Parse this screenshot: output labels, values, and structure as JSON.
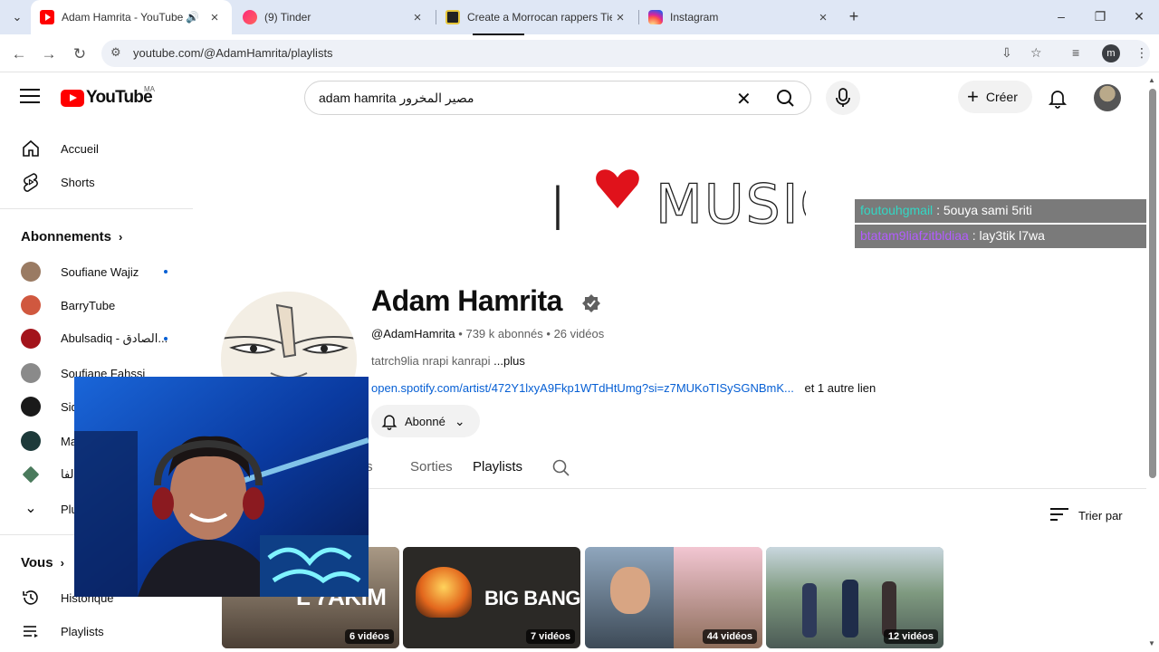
{
  "browser": {
    "tabs": [
      {
        "title": "Adam Hamrita - YouTube",
        "active": true
      },
      {
        "title": "(9) Tinder",
        "active": false
      },
      {
        "title": "Create a Morrocan rappers Tier",
        "active": false
      },
      {
        "title": "Instagram",
        "active": false
      }
    ],
    "url": "youtube.com/@AdamHamrita/playlists",
    "profile_initial": "m"
  },
  "youtube": {
    "logo_text": "YouTube",
    "country_code": "MA",
    "search_query": "adam hamrita مصير المخرور",
    "create_label": "Créer"
  },
  "sidebar": {
    "home": "Accueil",
    "shorts": "Shorts",
    "subscriptions_heading": "Abonnements",
    "subscriptions": [
      {
        "name": "Soufiane Wajiz",
        "new": true,
        "color": "#9a7b63"
      },
      {
        "name": "BarryTube",
        "new": false,
        "color": "#d0583f"
      },
      {
        "name": "Abulsadiq - الصادق...",
        "new": true,
        "color": "#a3141b"
      },
      {
        "name": "Soufiane Fahssi",
        "new": false,
        "color": "#8a8a8a"
      },
      {
        "name": "Sid",
        "new": false,
        "color": "#1a1a1a"
      },
      {
        "name": "Ma",
        "new": false,
        "color": "#1d3a3a"
      },
      {
        "name": "ية الفا",
        "new": false,
        "color": "#4a7a5c"
      }
    ],
    "more_label": "Plus",
    "you_heading": "Vous",
    "history": "Historique",
    "playlists": "Playlists"
  },
  "channel": {
    "name": "Adam Hamrita",
    "handle": "@AdamHamrita",
    "subscribers": "739 k abonnés",
    "videos": "26 vidéos",
    "description": "tatrch9lia nrapi kanrapi",
    "more": "...plus",
    "link": "open.spotify.com/artist/472Y1lxyA9Fkp1WTdHtUmg?si=z7MUKoTISySGNBmK...",
    "other_links": "et 1 autre lien",
    "subscribed_label": "Abonné",
    "banner_left_text": "I",
    "banner_right_text": "MUSIC"
  },
  "tabs": [
    {
      "label": "rts",
      "active": false
    },
    {
      "label": "Sorties",
      "active": false
    },
    {
      "label": "Playlists",
      "active": true
    }
  ],
  "sort_label": "Trier par",
  "playlists": [
    {
      "title_overlay": "L'7AKIM",
      "count": "6 vidéos",
      "bg": "#6d5c4e"
    },
    {
      "title_overlay": "BIG BANG",
      "count": "7 vidéos",
      "bg": "#2b2926"
    },
    {
      "title_overlay": "",
      "count": "44 vidéos",
      "bg": "#b7c7d8"
    },
    {
      "title_overlay": "",
      "count": "12 vidéos",
      "bg": "#7a8e93"
    }
  ],
  "chat": [
    {
      "user": "foutouhgmail",
      "message": ": 5ouya sami 5riti"
    },
    {
      "user": "btatam9liafzitbldiaa",
      "message": ": lay3tik l7wa"
    }
  ],
  "colors": {
    "yt_red": "#ff0000",
    "link_blue": "#065fd4",
    "chat_user1": "#33d7c4",
    "chat_user2": "#b35cff"
  }
}
